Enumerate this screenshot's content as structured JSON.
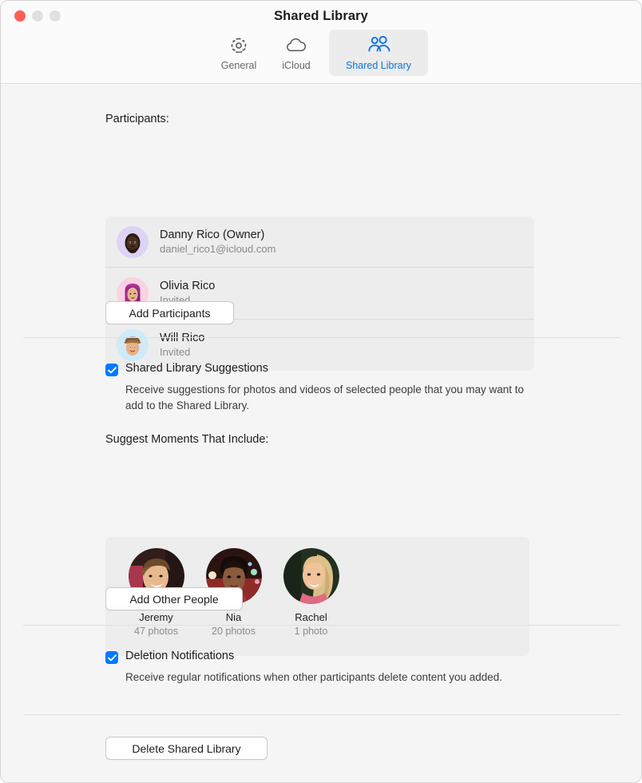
{
  "window": {
    "title": "Shared Library",
    "traffic_lights": [
      "close",
      "minimize",
      "zoom"
    ]
  },
  "toolbar": {
    "tabs": [
      {
        "label": "General",
        "icon": "gear-icon",
        "selected": false
      },
      {
        "label": "iCloud",
        "icon": "cloud-icon",
        "selected": false
      },
      {
        "label": "Shared Library",
        "icon": "people-icon",
        "selected": true
      }
    ],
    "accent_color": "#0a72e8",
    "selected_background": "#ececec"
  },
  "participants": {
    "label": "Participants:",
    "rows": [
      {
        "name": "Danny Rico (Owner)",
        "subtitle": "daniel_rico1@icloud.com",
        "avatar": "memoji-danny",
        "avatar_bg": "#ddd3f5"
      },
      {
        "name": "Olivia Rico",
        "subtitle": "Invited",
        "avatar": "memoji-olivia",
        "avatar_bg": "#fbd2e2"
      },
      {
        "name": "Will Rico",
        "subtitle": "Invited",
        "avatar": "memoji-will",
        "avatar_bg": "#cfeaf9"
      }
    ],
    "add_button": "Add Participants"
  },
  "suggestions": {
    "checkbox_label": "Shared Library Suggestions",
    "checked": true,
    "description": "Receive suggestions for photos and videos of selected people that you may want to add to the Shared Library.",
    "moments_label": "Suggest Moments That Include:",
    "people": [
      {
        "name": "Jeremy",
        "count": "47 photos",
        "photo": "photo-jeremy"
      },
      {
        "name": "Nia",
        "count": "20 photos",
        "photo": "photo-nia"
      },
      {
        "name": "Rachel",
        "count": "1 photo",
        "photo": "photo-rachel"
      }
    ],
    "add_button": "Add Other People"
  },
  "deletion": {
    "checkbox_label": "Deletion Notifications",
    "checked": true,
    "description": "Receive regular notifications when other participants delete content you added."
  },
  "footer": {
    "delete_button": "Delete Shared Library"
  },
  "colors": {
    "checkbox_blue": "#007aff",
    "close_red": "#ff5f57",
    "panel_gray": "#ededed",
    "content_bg": "#f5f5f5"
  }
}
